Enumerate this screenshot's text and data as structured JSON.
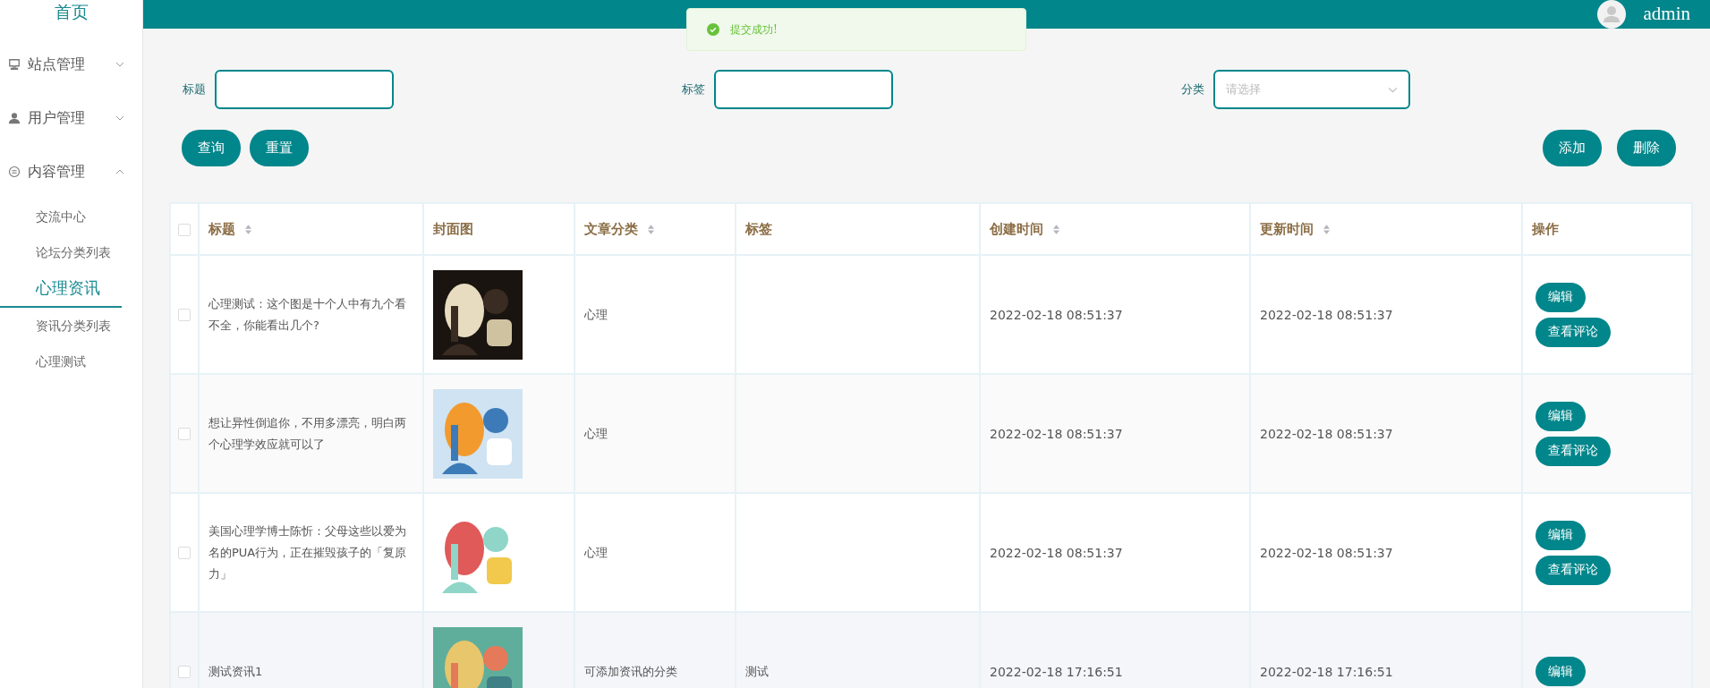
{
  "sidebar": {
    "home": "首页",
    "groups": [
      {
        "label": "站点管理",
        "expanded": false
      },
      {
        "label": "用户管理",
        "expanded": false
      },
      {
        "label": "内容管理",
        "expanded": true,
        "children": [
          {
            "label": "交流中心",
            "selected": false
          },
          {
            "label": "论坛分类列表",
            "selected": false
          },
          {
            "label": "心理资讯",
            "selected": true
          },
          {
            "label": "资讯分类列表",
            "selected": false
          },
          {
            "label": "心理测试",
            "selected": false
          }
        ]
      }
    ]
  },
  "header": {
    "user": "admin"
  },
  "toast": {
    "message": "提交成功!"
  },
  "filters": [
    {
      "kind": "input",
      "label": "标题"
    },
    {
      "kind": "input",
      "label": "标签"
    },
    {
      "kind": "select",
      "label": "分类",
      "placeholder": "请选择"
    }
  ],
  "left_buttons": [
    "查询",
    "重置"
  ],
  "right_buttons": [
    "添加",
    "删除"
  ],
  "table": {
    "select_all": {
      "checked": false
    },
    "columns": [
      {
        "label": "标题",
        "sortable": true
      },
      {
        "label": "封面图",
        "sortable": false
      },
      {
        "label": "文章分类",
        "sortable": true
      },
      {
        "label": "标签",
        "sortable": false
      },
      {
        "label": "创建时间",
        "sortable": true
      },
      {
        "label": "更新时间",
        "sortable": true
      },
      {
        "label": "操作",
        "sortable": false
      }
    ],
    "rows": [
      {
        "checked": false,
        "title": "心理测试：这个图是十个人中有九个看不全，你能看出几个?",
        "cover": {
          "kind": "picture"
        },
        "category": "心理",
        "created": "2022-02-18 08:51:37",
        "updated": "2022-02-18 08:51:37",
        "actions": [
          "编辑",
          "查看评论"
        ]
      },
      {
        "checked": false,
        "title": "想让异性倒追你，不用多漂亮，明白两个心理学效应就可以了",
        "cover": {
          "kind": "picture"
        },
        "category": "心理",
        "created": "2022-02-18 08:51:37",
        "updated": "2022-02-18 08:51:37",
        "actions": [
          "编辑",
          "查看评论"
        ]
      },
      {
        "checked": false,
        "title": "美国心理学博士陈忻：父母这些以爱为名的PUA行为，正在摧毁孩子的「复原力」",
        "cover": {
          "kind": "picture"
        },
        "category": "心理",
        "created": "2022-02-18 08:51:37",
        "updated": "2022-02-18 08:51:37",
        "actions": [
          "编辑",
          "查看评论"
        ]
      },
      {
        "checked": false,
        "title": "测试资讯1",
        "cover": {
          "kind": "picture"
        },
        "category": "可添加资讯的分类",
        "tag": "测试",
        "created": "2022-02-18 17:16:51",
        "updated": "2022-02-18 17:16:51",
        "actions": [
          "编辑"
        ]
      }
    ]
  }
}
